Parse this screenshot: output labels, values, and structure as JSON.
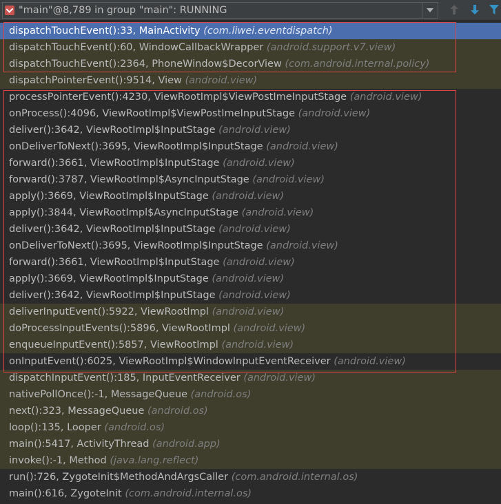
{
  "thread": {
    "label": "\"main\"@8,789 in group \"main\": RUNNING",
    "icon": "thread-breakpoint-icon"
  },
  "toolbar": {
    "icons": [
      "chevron-down-icon",
      "arrow-up-icon",
      "arrow-down-icon",
      "filter-icon"
    ]
  },
  "colors": {
    "selected_row": "#4b6eaf",
    "app_row": "#3f3d2c",
    "highlight_box": "#e04343"
  },
  "frames": [
    {
      "method": "dispatchTouchEvent():33, MainActivity",
      "pkg": "(com.liwei.eventdispatch)",
      "type": "selected"
    },
    {
      "method": "dispatchTouchEvent():60, WindowCallbackWrapper",
      "pkg": "(android.support.v7.view)",
      "type": "app"
    },
    {
      "method": "dispatchTouchEvent():2364, PhoneWindow$DecorView",
      "pkg": "(com.android.internal.policy)",
      "type": "app"
    },
    {
      "method": "dispatchPointerEvent():9514, View",
      "pkg": "(android.view)",
      "type": "app"
    },
    {
      "method": "processPointerEvent():4230, ViewRootImpl$ViewPostImeInputStage",
      "pkg": "(android.view)",
      "type": "lib"
    },
    {
      "method": "onProcess():4096, ViewRootImpl$ViewPostImeInputStage",
      "pkg": "(android.view)",
      "type": "lib"
    },
    {
      "method": "deliver():3642, ViewRootImpl$InputStage",
      "pkg": "(android.view)",
      "type": "lib"
    },
    {
      "method": "onDeliverToNext():3695, ViewRootImpl$InputStage",
      "pkg": "(android.view)",
      "type": "lib"
    },
    {
      "method": "forward():3661, ViewRootImpl$InputStage",
      "pkg": "(android.view)",
      "type": "lib"
    },
    {
      "method": "forward():3787, ViewRootImpl$AsyncInputStage",
      "pkg": "(android.view)",
      "type": "lib"
    },
    {
      "method": "apply():3669, ViewRootImpl$InputStage",
      "pkg": "(android.view)",
      "type": "lib"
    },
    {
      "method": "apply():3844, ViewRootImpl$AsyncInputStage",
      "pkg": "(android.view)",
      "type": "lib"
    },
    {
      "method": "deliver():3642, ViewRootImpl$InputStage",
      "pkg": "(android.view)",
      "type": "lib"
    },
    {
      "method": "onDeliverToNext():3695, ViewRootImpl$InputStage",
      "pkg": "(android.view)",
      "type": "lib"
    },
    {
      "method": "forward():3661, ViewRootImpl$InputStage",
      "pkg": "(android.view)",
      "type": "lib"
    },
    {
      "method": "apply():3669, ViewRootImpl$InputStage",
      "pkg": "(android.view)",
      "type": "lib"
    },
    {
      "method": "deliver():3642, ViewRootImpl$InputStage",
      "pkg": "(android.view)",
      "type": "lib"
    },
    {
      "method": "deliverInputEvent():5922, ViewRootImpl",
      "pkg": "(android.view)",
      "type": "app"
    },
    {
      "method": "doProcessInputEvents():5896, ViewRootImpl",
      "pkg": "(android.view)",
      "type": "app"
    },
    {
      "method": "enqueueInputEvent():5857, ViewRootImpl",
      "pkg": "(android.view)",
      "type": "app"
    },
    {
      "method": "onInputEvent():6025, ViewRootImpl$WindowInputEventReceiver",
      "pkg": "(android.view)",
      "type": "lib"
    },
    {
      "method": "dispatchInputEvent():185, InputEventReceiver",
      "pkg": "(android.view)",
      "type": "app"
    },
    {
      "method": "nativePollOnce():-1, MessageQueue",
      "pkg": "(android.os)",
      "type": "app"
    },
    {
      "method": "next():323, MessageQueue",
      "pkg": "(android.os)",
      "type": "app"
    },
    {
      "method": "loop():135, Looper",
      "pkg": "(android.os)",
      "type": "app"
    },
    {
      "method": "main():5417, ActivityThread",
      "pkg": "(android.app)",
      "type": "app"
    },
    {
      "method": "invoke():-1, Method",
      "pkg": "(java.lang.reflect)",
      "type": "app"
    },
    {
      "method": "run():726, ZygoteInit$MethodAndArgsCaller",
      "pkg": "(com.android.internal.os)",
      "type": "lib"
    },
    {
      "method": "main():616, ZygoteInit",
      "pkg": "(com.android.internal.os)",
      "type": "lib"
    }
  ]
}
